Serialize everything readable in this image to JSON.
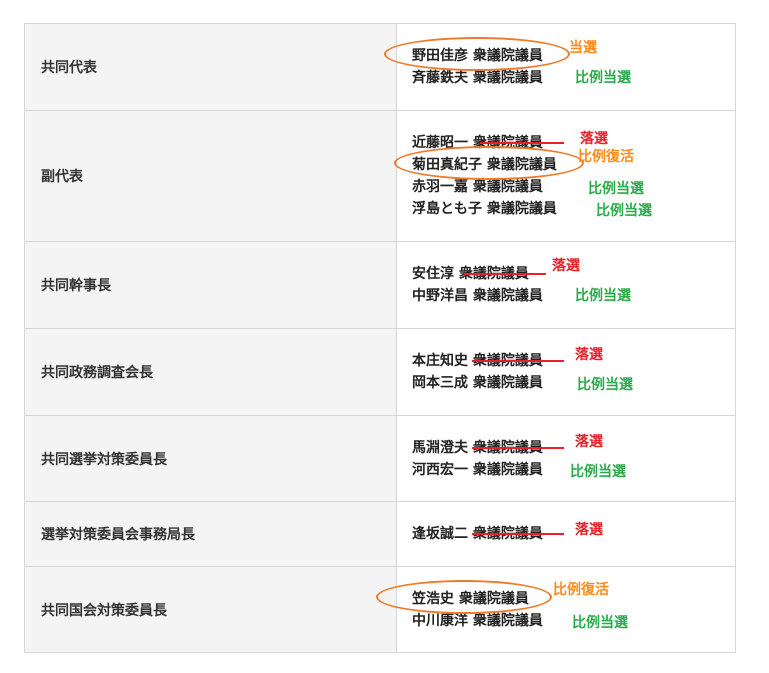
{
  "rows": [
    {
      "role": "共同代表",
      "members": [
        {
          "name": "野田佳彦",
          "title": "衆議院議員",
          "result": "当選",
          "result_type": "win",
          "circled": true
        },
        {
          "name": "斉藤鉄夫",
          "title": "衆議院議員",
          "result": "比例当選",
          "result_type": "pr"
        }
      ]
    },
    {
      "role": "副代表",
      "members": [
        {
          "name": "近藤昭一",
          "title": "衆議院議員",
          "result": "落選",
          "result_type": "lose",
          "struck": true
        },
        {
          "name": "菊田真紀子",
          "title": "衆議院議員",
          "result": "比例復活",
          "result_type": "rev",
          "circled": true
        },
        {
          "name": "赤羽一嘉",
          "title": "衆議院議員",
          "result": "比例当選",
          "result_type": "pr"
        },
        {
          "name": "浮島とも子",
          "title": "衆議院議員",
          "result": "比例当選",
          "result_type": "pr"
        }
      ]
    },
    {
      "role": "共同幹事長",
      "members": [
        {
          "name": "安住淳",
          "title": "衆議院議員",
          "result": "落選",
          "result_type": "lose",
          "struck": true
        },
        {
          "name": "中野洋昌",
          "title": "衆議院議員",
          "result": "比例当選",
          "result_type": "pr"
        }
      ]
    },
    {
      "role": "共同政務調査会長",
      "members": [
        {
          "name": "本庄知史",
          "title": "衆議院議員",
          "result": "落選",
          "result_type": "lose",
          "struck": true
        },
        {
          "name": "岡本三成",
          "title": "衆議院議員",
          "result": "比例当選",
          "result_type": "pr"
        }
      ]
    },
    {
      "role": "共同選挙対策委員長",
      "members": [
        {
          "name": "馬淵澄夫",
          "title": "衆議院議員",
          "result": "落選",
          "result_type": "lose",
          "struck": true
        },
        {
          "name": "河西宏一",
          "title": "衆議院議員",
          "result": "比例当選",
          "result_type": "pr"
        }
      ]
    },
    {
      "role": "選挙対策委員会事務局長",
      "members": [
        {
          "name": "逢坂誠二",
          "title": "衆議院議員",
          "result": "落選",
          "result_type": "lose",
          "struck": true
        }
      ]
    },
    {
      "role": "共同国会対策委員長",
      "members": [
        {
          "name": "笠浩史",
          "title": "衆議院議員",
          "result": "比例復活",
          "result_type": "rev",
          "circled": true
        },
        {
          "name": "中川康洋",
          "title": "衆議院議員",
          "result": "比例当選",
          "result_type": "pr"
        }
      ]
    }
  ]
}
